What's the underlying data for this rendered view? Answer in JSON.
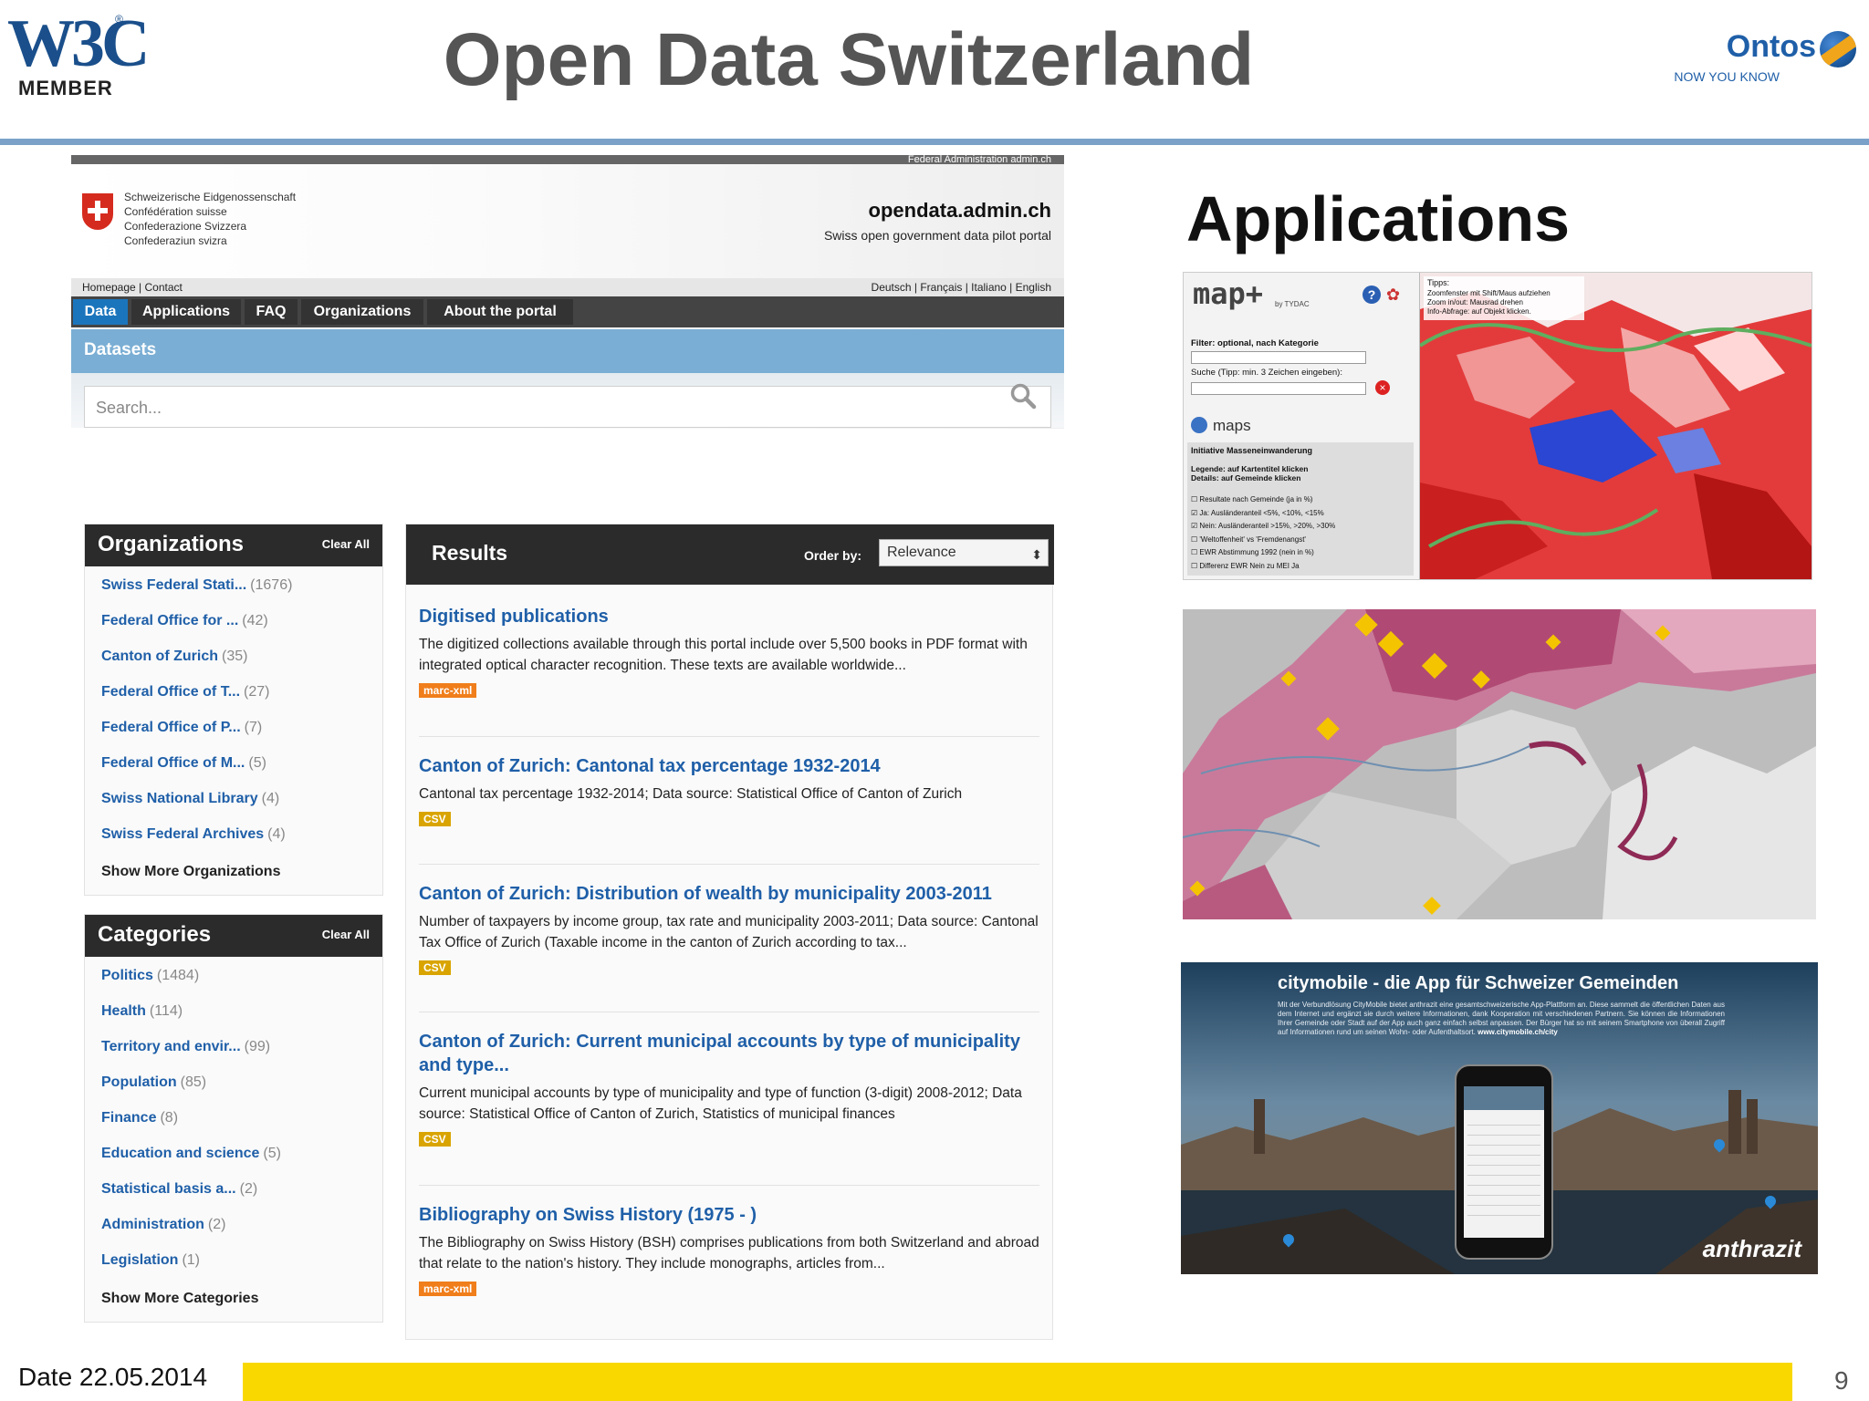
{
  "header": {
    "w3c_logo_text": "W3C",
    "w3c_member_text": "MEMBER",
    "title": "Open Data Switzerland",
    "ontos_name": "Ontos",
    "ontos_tagline": "NOW YOU KNOW"
  },
  "portal": {
    "top_strip": "Federal Administration admin.ch",
    "confederation_lines": [
      "Schweizerische Eidgenossenschaft",
      "Confédération suisse",
      "Confederazione Svizzera",
      "Confederaziun svizra"
    ],
    "domain": "opendata.admin.ch",
    "subtitle": "Swiss open government data pilot portal",
    "utility_left": "Homepage | Contact",
    "utility_right": "Deutsch | Français | Italiano | English",
    "nav_tabs": [
      "Data",
      "Applications",
      "FAQ",
      "Organizations",
      "About the portal"
    ],
    "datasets_title": "Datasets",
    "search_placeholder": "Search...",
    "organizations": {
      "title": "Organizations",
      "clear_label": "Clear All",
      "items": [
        {
          "label": "Swiss Federal Stati...",
          "count": "(1676)"
        },
        {
          "label": "Federal Office for ...",
          "count": "(42)"
        },
        {
          "label": "Canton of Zurich",
          "count": "(35)"
        },
        {
          "label": "Federal Office of T...",
          "count": "(27)"
        },
        {
          "label": "Federal Office of P...",
          "count": "(7)"
        },
        {
          "label": "Federal Office of M...",
          "count": "(5)"
        },
        {
          "label": "Swiss National Library",
          "count": "(4)"
        },
        {
          "label": "Swiss Federal Archives",
          "count": "(4)"
        }
      ],
      "more_label": "Show More Organizations"
    },
    "categories": {
      "title": "Categories",
      "clear_label": "Clear All",
      "items": [
        {
          "label": "Politics",
          "count": "(1484)"
        },
        {
          "label": "Health",
          "count": "(114)"
        },
        {
          "label": "Territory and envir...",
          "count": "(99)"
        },
        {
          "label": "Population",
          "count": "(85)"
        },
        {
          "label": "Finance",
          "count": "(8)"
        },
        {
          "label": "Education and science",
          "count": "(5)"
        },
        {
          "label": "Statistical basis a...",
          "count": "(2)"
        },
        {
          "label": "Administration",
          "count": "(2)"
        },
        {
          "label": "Legislation",
          "count": "(1)"
        }
      ],
      "more_label": "Show More Categories"
    },
    "results": {
      "title": "Results",
      "order_by_label": "Order by:",
      "order_by_value": "Relevance",
      "items": [
        {
          "title": "Digitised publications",
          "desc": "The digitized collections available through this portal include over 5,500 books in PDF format with integrated optical character recognition. These texts are available worldwide...",
          "badge": "marc-xml"
        },
        {
          "title": "Canton of Zurich: Cantonal tax percentage 1932-2014",
          "desc": "Cantonal tax percentage 1932-2014; Data source: Statistical Office of Canton of Zurich",
          "badge": "CSV"
        },
        {
          "title": "Canton of Zurich: Distribution of wealth by municipality 2003-2011",
          "desc": "Number of taxpayers by income group, tax rate and municipality 2003-2011; Data source: Cantonal Tax Office of Zurich (Taxable income in the canton of Zurich according to tax...",
          "badge": "CSV"
        },
        {
          "title": "Canton of Zurich: Current municipal accounts by type of municipality and type...",
          "desc": "Current municipal accounts by type of municipality and type of function (3-digit) 2008-2012; Data source: Statistical Office of Canton of Zurich, Statistics of municipal finances",
          "badge": "CSV"
        },
        {
          "title": "Bibliography on Swiss History (1975 - )",
          "desc": "The Bibliography on Swiss History (BSH) comprises publications from both Switzerland and abroad that relate to the nation's history. They include monographs, articles from...",
          "badge": "marc-xml"
        }
      ]
    }
  },
  "applications": {
    "title": "Applications",
    "mapplus": {
      "logo": "map+",
      "by": "by TYDAC",
      "filter_label": "Filter: optional, nach Kategorie",
      "search_label": "Suche (Tipp: min. 3 Zeichen eingeben):",
      "maps_label": "maps",
      "layer_title": "Initiative Masseneinwanderung",
      "legend_line1": "Legende: auf Kartentitel klicken",
      "legend_line2": "Details: auf Gemeinde klicken",
      "layers": [
        "Resultate nach Gemeinde (ja in %)",
        "Ja: Ausländeranteil <5%, <10%, <15%",
        "Nein: Ausländeranteil >15%, >20%, >30%",
        "'Weltoffenheit' vs 'Fremdenangst'",
        "EWR Abstimmung 1992 (nein in %)",
        "Differenz EWR Nein zu MEI Ja"
      ],
      "tips_lines": [
        "Tipps:",
        "Zoomfenster mit Shift/Maus aufziehen",
        "Zoom in/out: Mausrad drehen",
        "Info-Abfrage: auf Objekt klicken."
      ]
    },
    "citymobile": {
      "headline": "citymobile - die App für Schweizer Gemeinden",
      "body": "Mit der Verbundlösung CityMobile bietet anthrazit eine gesamtschweizerische App-Plattform an. Diese sammelt die öffentlichen Daten aus dem Internet und ergänzt sie durch weitere Informationen, dank Kooperation mit verschiedenen Partnern. Sie können die Informationen Ihrer Gemeinde oder Stadt auf der App auch ganz einfach selbst anpassen. Der Bürger hat so mit seinem Smartphone von überall Zugriff auf Informationen rund um seinen Wohn- oder Aufenthaltsort.",
      "url": "www.citymobile.ch/city",
      "brand": "anthrazit"
    }
  },
  "footer": {
    "date": "Date 22.05.2014",
    "page_number": "9"
  },
  "colors": {
    "title_gray": "#555555",
    "link_blue": "#1f5fa8",
    "nav_active": "#1b75bc",
    "datasets_bar": "#7aaed4",
    "badge_marc": "#f07e1b",
    "badge_csv": "#d9a400",
    "footer_yellow": "#f9d800",
    "header_rule": "#7ba1c9"
  }
}
